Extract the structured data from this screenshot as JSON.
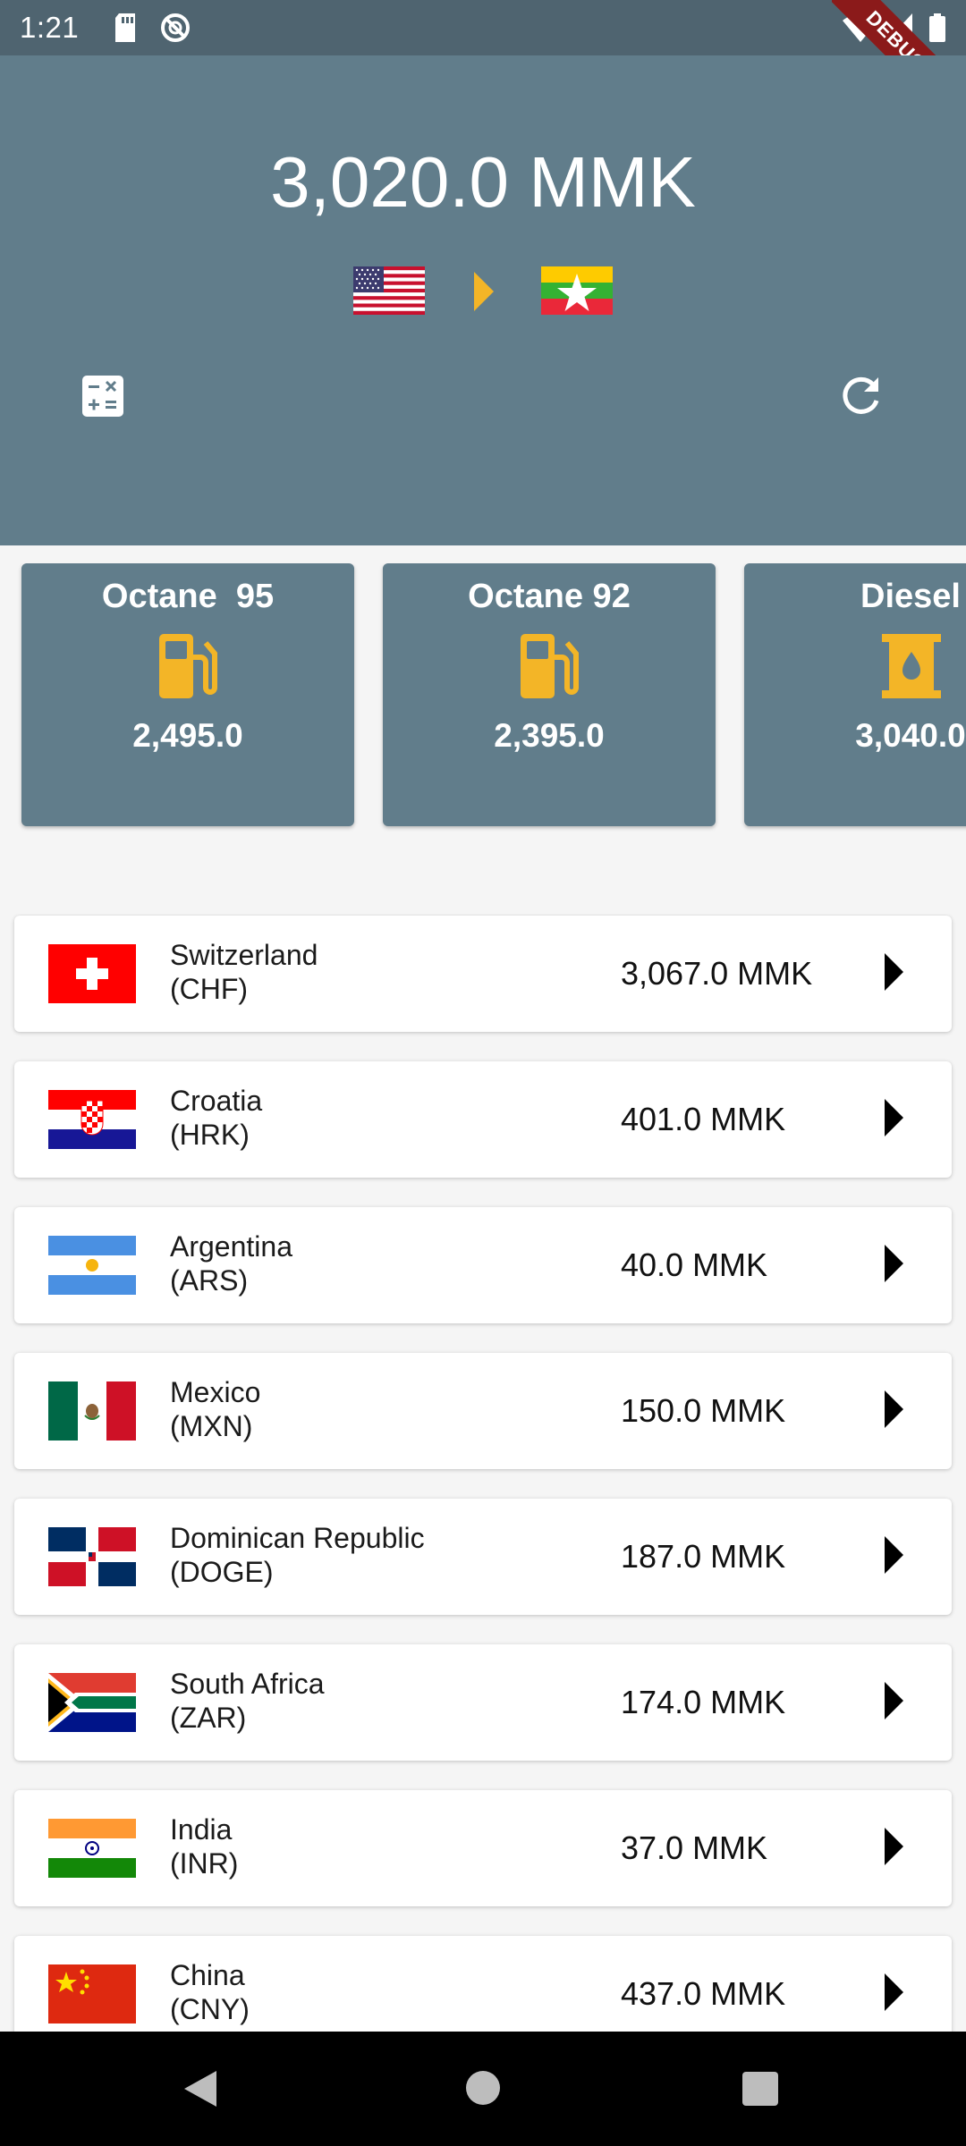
{
  "status_bar": {
    "time": "1:21",
    "debug_label": "DEBUG"
  },
  "header": {
    "rate": "3,020.0 MMK",
    "from_flag": "united-states-flag",
    "to_flag": "myanmar-flag",
    "colors": {
      "background": "#617d8b",
      "accent": "#f3b527"
    }
  },
  "fuels": [
    {
      "name": "Octane  95",
      "icon": "gas-station-icon",
      "price": "2,495.0"
    },
    {
      "name": "Octane 92",
      "icon": "gas-station-icon",
      "price": "2,395.0"
    },
    {
      "name": "Diesel",
      "icon": "oil-barrel-icon",
      "price": "3,040.0"
    }
  ],
  "currencies": [
    {
      "country": "Switzerland",
      "code": "(CHF)",
      "value": "3,067.0 MMK",
      "flag": "switzerland"
    },
    {
      "country": "Croatia",
      "code": "(HRK)",
      "value": "401.0 MMK",
      "flag": "croatia"
    },
    {
      "country": "Argentina",
      "code": "(ARS)",
      "value": "40.0 MMK",
      "flag": "argentina"
    },
    {
      "country": "Mexico",
      "code": "(MXN)",
      "value": "150.0 MMK",
      "flag": "mexico"
    },
    {
      "country": "Dominican Republic",
      "code": "(DOGE)",
      "value": "187.0 MMK",
      "flag": "dominican-republic"
    },
    {
      "country": "South Africa",
      "code": "(ZAR)",
      "value": "174.0 MMK",
      "flag": "south-africa"
    },
    {
      "country": "India",
      "code": "(INR)",
      "value": "37.0 MMK",
      "flag": "india"
    },
    {
      "country": "China",
      "code": "(CNY)",
      "value": "437.0 MMK",
      "flag": "china"
    }
  ]
}
